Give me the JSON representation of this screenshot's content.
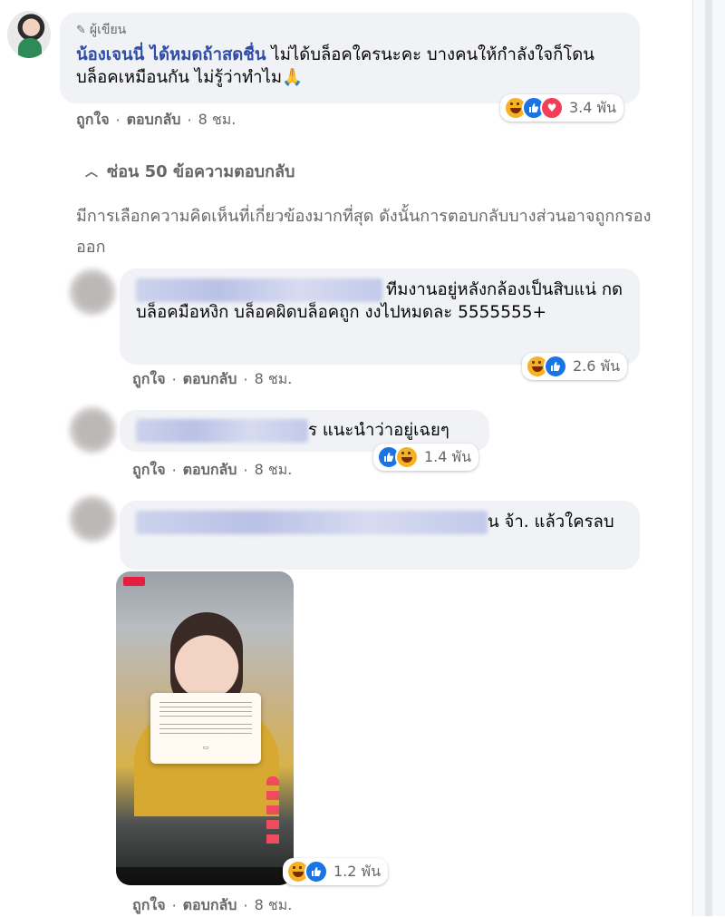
{
  "author_comment": {
    "author_badge": "ผู้เขียน",
    "name": "น้องเจนนี่ ได้หมดถ้าสดชื่น",
    "text": " ไม่ได้บล็อคใครนะคะ บางคนให้กำลังใจก็โดนบล็อคเหมือนกัน ไม่รู้ว่าทำไม",
    "emoji": "🙏",
    "reactions": [
      "haha-icon",
      "like-icon",
      "love-icon"
    ],
    "reaction_count": "3.4 พัน",
    "like_label": "ถูกใจ",
    "reply_label": "ตอบกลับ",
    "time": "8 ชม."
  },
  "hide_replies_label": "ซ่อน 50 ข้อความตอบกลับ",
  "filter_note": "มีการเลือกความคิดเห็นที่เกี่ยวข้องมากที่สุด ดังนั้นการตอบกลับบางส่วนอาจถูกกรองออก",
  "replies": [
    {
      "text": "ทีมงานอยู่หลังกล้องเป็นสิบแน่ กดบล็อคมือหงิก บล็อคผิดบล็อคถูก งงไปหมดละ 5555555+",
      "reactions": [
        "haha-icon",
        "like-icon"
      ],
      "reaction_count": "2.6 พัน",
      "like_label": "ถูกใจ",
      "reply_label": "ตอบกลับ",
      "time": "8 ชม."
    },
    {
      "text_prefix": "ร",
      "text": "แนะนำว่าอยู่เฉยๆ",
      "reactions": [
        "like-icon",
        "haha-icon"
      ],
      "reaction_count": "1.4 พัน",
      "like_label": "ถูกใจ",
      "reply_label": "ตอบกลับ",
      "time": "8 ชม."
    },
    {
      "text_prefix": "น",
      "text": "จ้า. แล้วใครลบ",
      "reactions": [
        "haha-icon",
        "like-icon"
      ],
      "reaction_count": "1.2 พัน",
      "like_label": "ถูกใจ",
      "reply_label": "ตอบกลับ",
      "time": "8 ชม."
    }
  ],
  "colors": {
    "author_name": "#2d4da8",
    "bubble": "#f0f2f5",
    "secondary_text": "#65676b",
    "like_blue": "#1b74e4",
    "haha_yellow": "#f7b125",
    "love_red": "#f33e58"
  }
}
